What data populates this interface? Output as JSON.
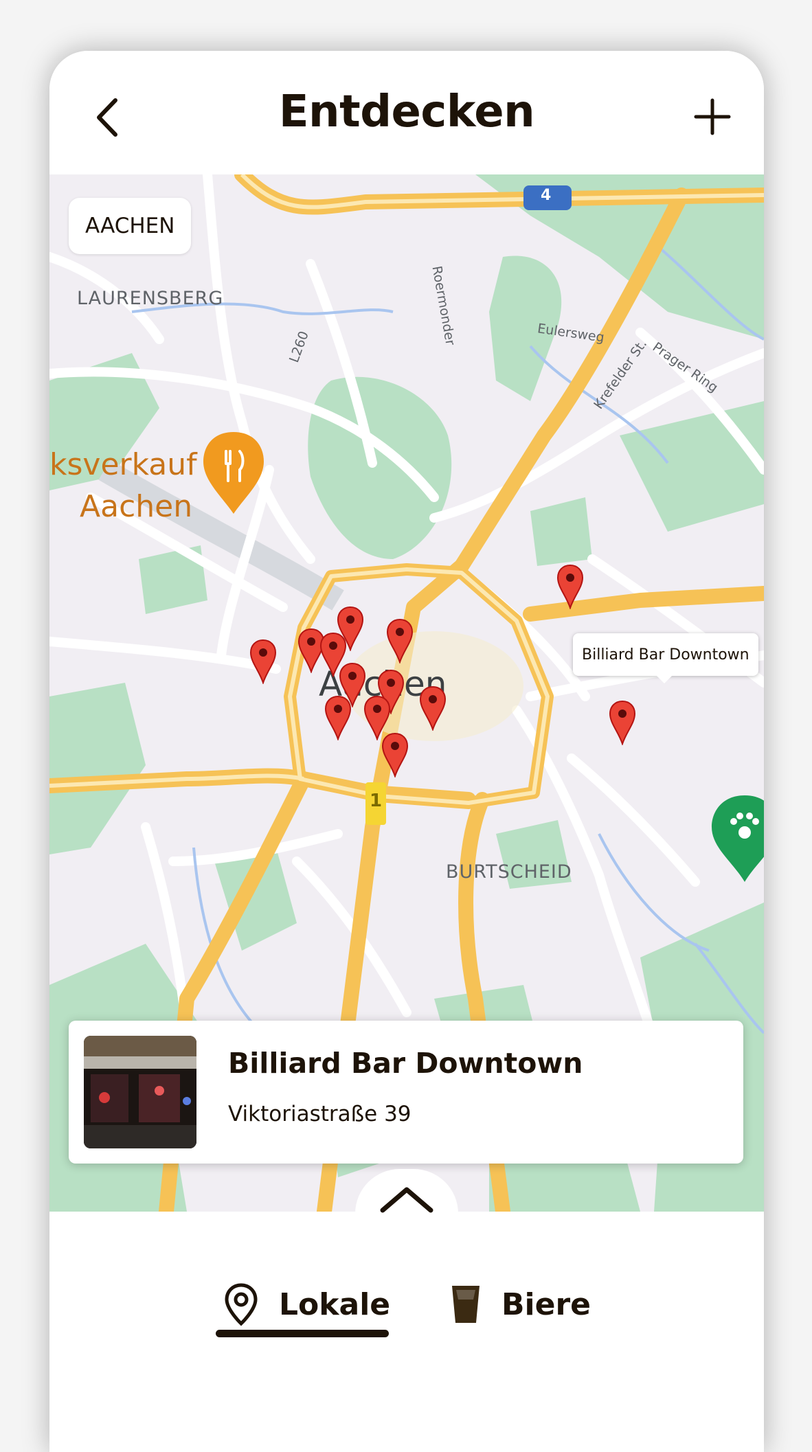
{
  "header": {
    "title": "Entdecken",
    "back_icon": "chevron-left-icon",
    "add_icon": "plus-icon"
  },
  "map": {
    "city_chip": "AACHEN",
    "labels": {
      "laurensberg": "LAURENSBERG",
      "city": "Aachen",
      "burtscheid": "BURTSCHEID",
      "poi_line1": "ksverkauf",
      "poi_line2": "Aachen",
      "motorway_4": "4",
      "road_1": "1",
      "street_eulersweg": "Eulersweg",
      "street_krefelder": "Krefelder St.",
      "street_prager": "Prager Ring",
      "street_roermonder": "Roermonder",
      "street_l260": "L260"
    },
    "selected_tooltip": "Billiard Bar Downtown",
    "poi_restaurant_icon": "fork-knife-icon",
    "poi_pet_icon": "paw-icon",
    "pin_icon": "map-pin-icon"
  },
  "venue_card": {
    "name": "Billiard Bar Downtown",
    "address": "Viktoriastraße 39",
    "photo_icon": "bar-photo"
  },
  "bottom_sheet": {
    "handle_icon": "chevron-up-icon",
    "tabs": [
      {
        "label": "Lokale",
        "icon": "location-pin-icon",
        "active": true
      },
      {
        "label": "Biere",
        "icon": "beer-glass-icon",
        "active": false
      }
    ]
  },
  "colors": {
    "text": "#1d1308",
    "pin": "#ea4335",
    "map_bg": "#f1eef3",
    "park": "#b8e0c4",
    "motorway": "#f6c256"
  }
}
